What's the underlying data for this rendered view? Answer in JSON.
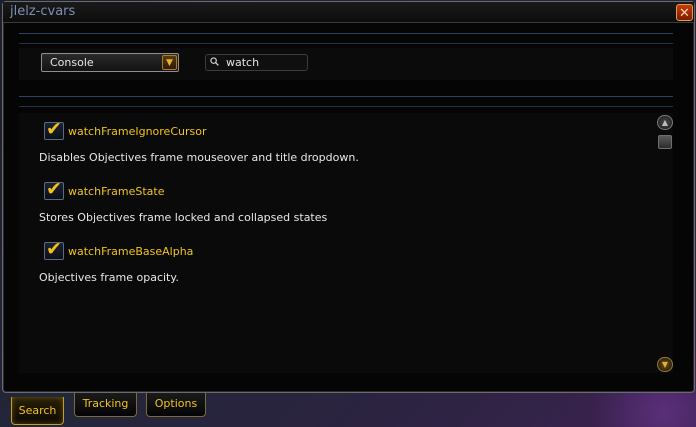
{
  "window": {
    "title": "jlelz-cvars",
    "close_label": "✕"
  },
  "toolbar": {
    "dropdown_value": "Console",
    "dropdown_arrow_icon": "arrow-down-icon",
    "search_value": "watch",
    "search_icon": "search-icon"
  },
  "items": [
    {
      "name": "watchFrameIgnoreCursor",
      "desc": "Disables Objectives frame mouseover and title dropdown.",
      "checked": true
    },
    {
      "name": "watchFrameState",
      "desc": "Stores Objectives frame locked and collapsed states",
      "checked": true
    },
    {
      "name": "watchFrameBaseAlpha",
      "desc": "Objectives frame opacity.",
      "checked": true
    }
  ],
  "check_glyph": "✔",
  "tabs": [
    {
      "label": "Search",
      "active": true
    },
    {
      "label": "Tracking",
      "active": false
    },
    {
      "label": "Options",
      "active": false
    }
  ],
  "colors": {
    "accent_gold": "#f0c419",
    "title_blue": "#7d8fb3",
    "close_red": "#c43a12"
  }
}
